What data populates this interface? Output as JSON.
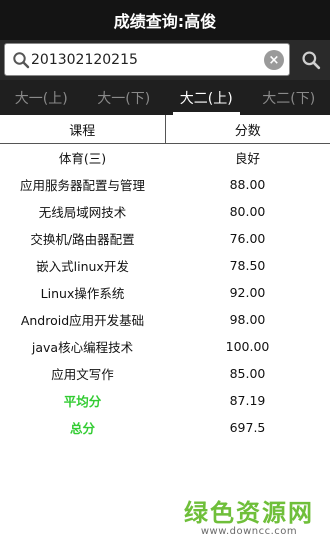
{
  "title": "成绩查询:高俊",
  "search": {
    "value": "201302120215",
    "clear_label": "×"
  },
  "tabs": [
    {
      "label": "大一(上)",
      "active": false
    },
    {
      "label": "大一(下)",
      "active": false
    },
    {
      "label": "大二(上)",
      "active": true
    },
    {
      "label": "大二(下)",
      "active": false
    }
  ],
  "table": {
    "headers": [
      "课程",
      "分数"
    ],
    "rows": [
      {
        "course": "体育(三)",
        "score": "良好"
      },
      {
        "course": "应用服务器配置与管理",
        "score": "88.00"
      },
      {
        "course": "无线局域网技术",
        "score": "80.00"
      },
      {
        "course": "交换机/路由器配置",
        "score": "76.00"
      },
      {
        "course": "嵌入式linux开发",
        "score": "78.50"
      },
      {
        "course": "Linux操作系统",
        "score": "92.00"
      },
      {
        "course": "Android应用开发基础",
        "score": "98.00"
      },
      {
        "course": "java核心编程技术",
        "score": "100.00"
      },
      {
        "course": "应用文写作",
        "score": "85.00"
      }
    ],
    "summary": [
      {
        "label": "平均分",
        "value": "87.19"
      },
      {
        "label": "总分",
        "value": "697.5"
      }
    ]
  },
  "colors": {
    "summary_label": "#33cc33",
    "watermark_logo": "#6fbf3a",
    "titlebar_bg": "#141414",
    "tabs_bg": "#1f1f1f"
  },
  "watermark": {
    "logo": "绿色资源网",
    "url": "www.downcc.com"
  }
}
